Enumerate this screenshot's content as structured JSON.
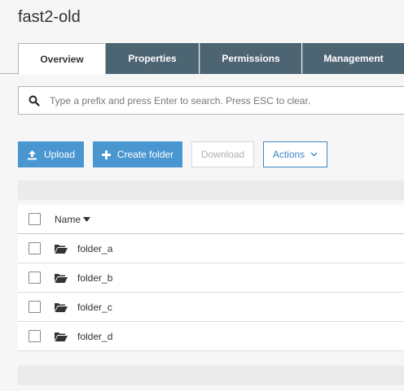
{
  "bucket": {
    "title": "fast2-old"
  },
  "tabs": [
    {
      "label": "Overview",
      "active": true
    },
    {
      "label": "Properties",
      "active": false
    },
    {
      "label": "Permissions",
      "active": false
    },
    {
      "label": "Management",
      "active": false
    }
  ],
  "search": {
    "placeholder": "Type a prefix and press Enter to search. Press ESC to clear.",
    "value": ""
  },
  "toolbar": {
    "upload_label": "Upload",
    "create_folder_label": "Create folder",
    "download_label": "Download",
    "actions_label": "Actions"
  },
  "table": {
    "columns": [
      {
        "label": "Name",
        "sort": "descending"
      }
    ],
    "rows": [
      {
        "name": "folder_a",
        "type": "folder"
      },
      {
        "name": "folder_b",
        "type": "folder"
      },
      {
        "name": "folder_c",
        "type": "folder"
      },
      {
        "name": "folder_d",
        "type": "folder"
      }
    ]
  },
  "colors": {
    "tab_bg": "#4d6473",
    "primary_button": "#4a96d1",
    "actions_border": "#3a86c8"
  }
}
